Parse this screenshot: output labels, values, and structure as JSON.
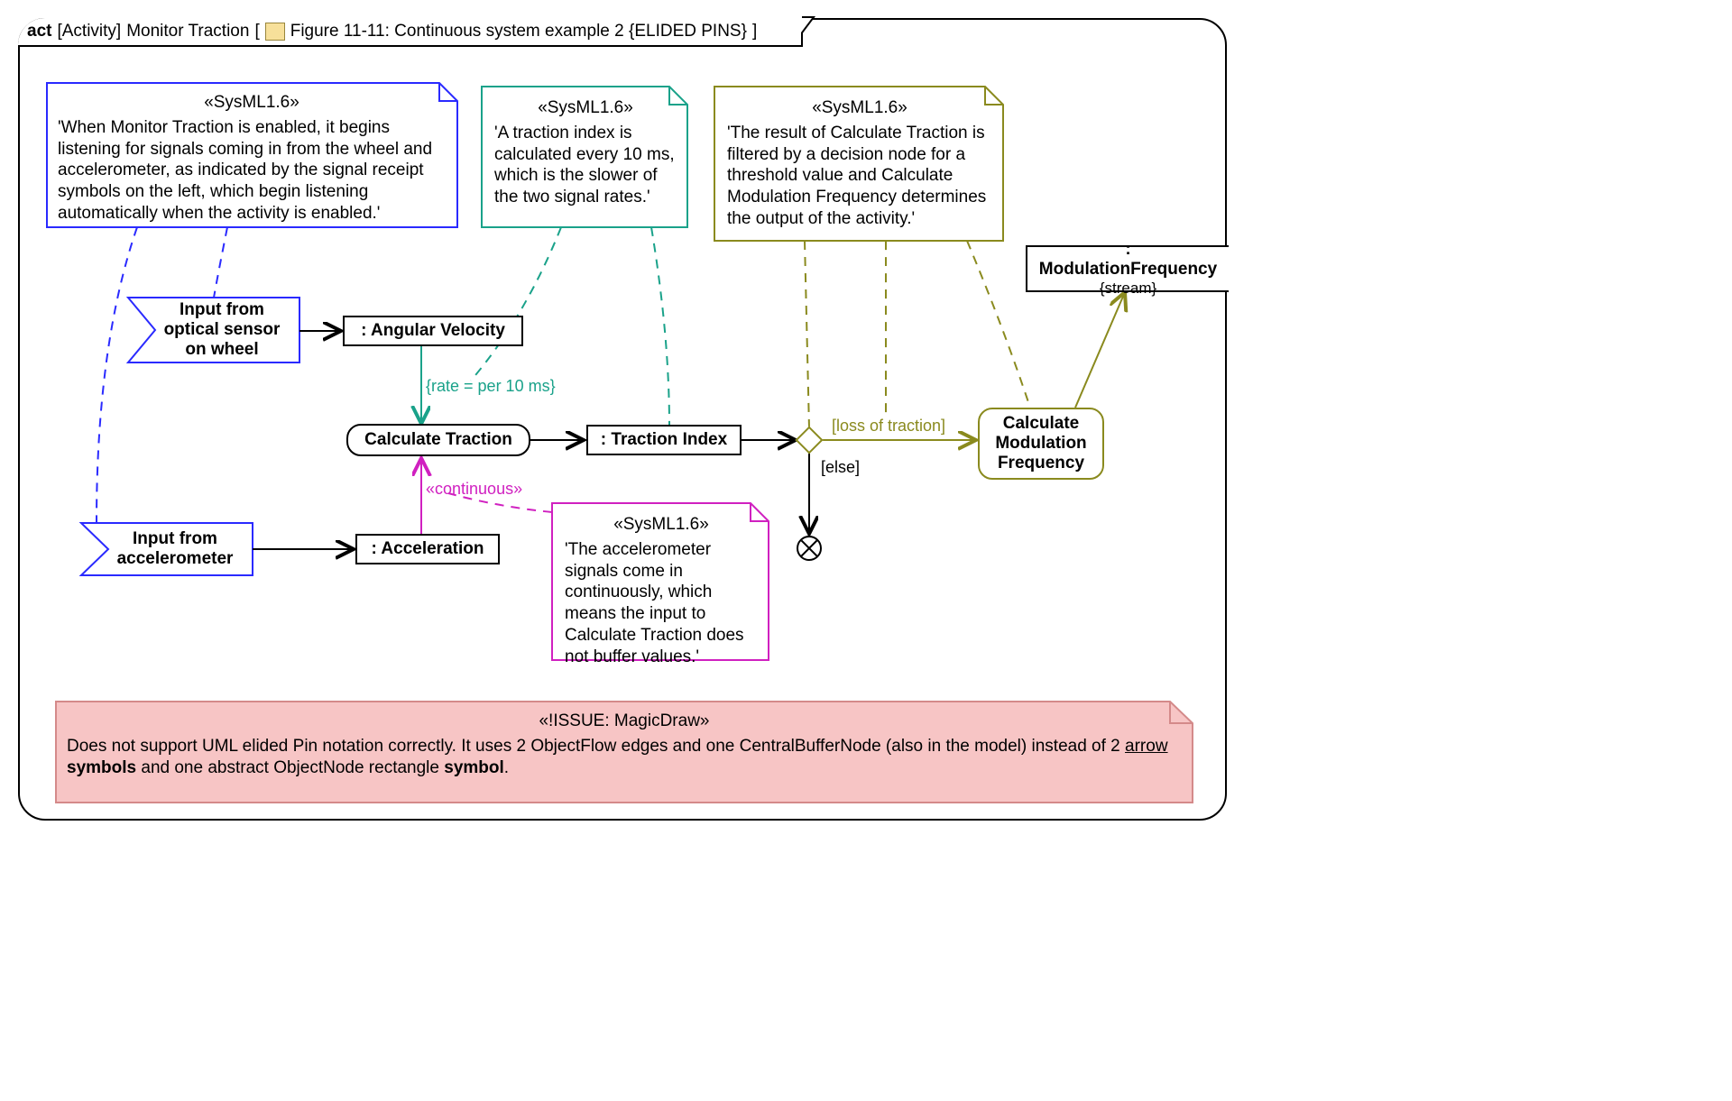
{
  "header": {
    "kind": "act",
    "stereo": "[Activity]",
    "name": "Monitor Traction",
    "caption": "Figure 11-11: Continuous system example 2  {ELIDED PINS}"
  },
  "notes": {
    "blue": {
      "stereo": "«SysML1.6»",
      "text": "'When Monitor Traction is enabled, it begins listening for signals coming in from the wheel and accelerometer, as indicated by the signal receipt symbols on the left, which begin listening automatically when the activity is enabled.'"
    },
    "teal": {
      "stereo": "«SysML1.6»",
      "text": "'A traction index is calculated every 10 ms, which is the slower of the two signal rates.'"
    },
    "olive": {
      "stereo": "«SysML1.6»",
      "text": "'The result of Calculate Traction is filtered by a decision node for a threshold value and Calculate Modulation Frequency determines the output of the activity.'"
    },
    "magenta": {
      "stereo": "«SysML1.6»",
      "text": "'The accelerometer signals come in continuously, which means the input to Calculate Traction does not buffer values.'"
    },
    "issue": {
      "stereo": "«!ISSUE: MagicDraw»",
      "text_pre": "Does not support UML elided Pin notation correctly. It uses 2 ObjectFlow edges and one CentralBufferNode (also in the model) instead of 2 ",
      "u1": "arrow",
      "mid1": " ",
      "b1": "symbols",
      "mid2": " and one abstract ObjectNode rectangle ",
      "b2": "symbol",
      "tail": "."
    }
  },
  "signals": {
    "optical": "Input from optical sensor on wheel",
    "accel": "Input from accelerometer"
  },
  "objects": {
    "angular": ": Angular Velocity",
    "accel": ": Acceleration",
    "traction_index": ": Traction Index",
    "mod_freq": ": ModulationFrequency",
    "mod_freq_stream": "{stream}"
  },
  "actions": {
    "calc_traction": "Calculate Traction",
    "calc_mod": "Calculate Modulation Frequency"
  },
  "labels": {
    "rate": "{rate = per 10 ms}",
    "continuous": "«continuous»",
    "loss": "[loss of traction]",
    "else": "[else]"
  },
  "colors": {
    "blue": "#2a2aff",
    "teal": "#1aa28a",
    "olive": "#8a8a1e",
    "magenta": "#d020c0",
    "pink_bg": "#f7c5c5",
    "pink_border": "#d48a8a"
  }
}
